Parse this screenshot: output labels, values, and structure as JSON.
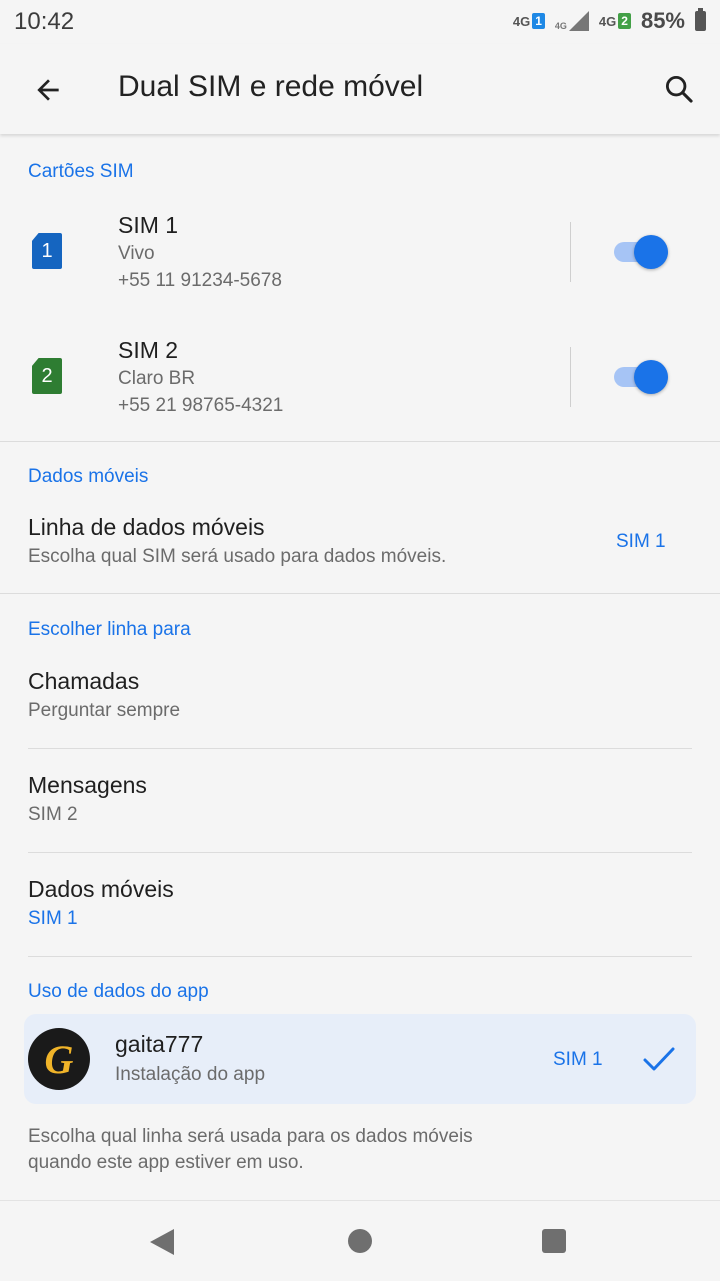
{
  "status_bar": {
    "time": "10:42",
    "net1_label": "4G",
    "net2_label": "4G",
    "net3_label": "4G",
    "sim1_badge": "1",
    "sim2_badge": "2",
    "battery": "85%"
  },
  "header": {
    "title": "Dual SIM e rede móvel",
    "back_icon": "arrow-left-icon",
    "search_icon": "search-icon"
  },
  "sim_cards": {
    "section_title": "Cartões SIM",
    "items": [
      {
        "icon_label": "1",
        "name": "SIM 1",
        "carrier": "Vivo",
        "number": "+55 11 91234-5678",
        "enabled": true,
        "color": "#1565c0"
      },
      {
        "icon_label": "2",
        "name": "SIM 2",
        "carrier": "Claro BR",
        "number": "+55 21 98765-4321",
        "enabled": true,
        "color": "#2e7d32"
      }
    ]
  },
  "mobile_data": {
    "section_title": "Dados móveis",
    "line_title": "Linha de dados móveis",
    "line_desc": "Escolha qual SIM será usado para dados móveis.",
    "line_value": "SIM 1"
  },
  "choose_line": {
    "section_title": "Escolher linha para",
    "items": [
      {
        "title": "Chamadas",
        "value": "Perguntar sempre"
      },
      {
        "title": "Mensagens",
        "value": "SIM 2"
      },
      {
        "title": "Dados móveis",
        "value": "SIM 1"
      }
    ]
  },
  "app_data": {
    "section_title": "Uso de dados do app",
    "app_name": "gaita777",
    "app_subtitle": "Instalação do app",
    "app_sim": "SIM 1",
    "logo_letter": "G",
    "footer_line1": "Escolha qual linha será usada para os dados móveis",
    "footer_line2": "quando este app estiver em uso."
  },
  "colors": {
    "accent": "#1a73e8",
    "background": "#f5f5f5",
    "card": "#e7eef9"
  }
}
